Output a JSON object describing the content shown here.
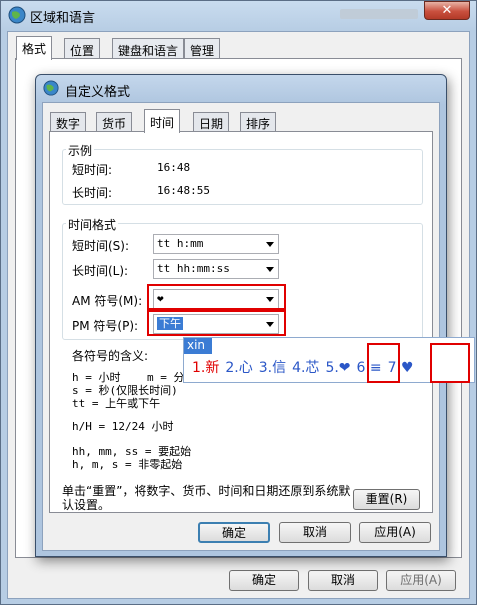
{
  "region_window": {
    "title": "区域和语言",
    "close_glyph": "✕",
    "tabs": [
      {
        "label": "格式"
      },
      {
        "label": "位置"
      },
      {
        "label": "键盘和语言"
      },
      {
        "label": "管理"
      }
    ],
    "buttons": {
      "ok": "确定",
      "cancel": "取消",
      "apply": "应用(A)"
    }
  },
  "custom_window": {
    "title": "自定义格式",
    "tabs": [
      {
        "label": "数字"
      },
      {
        "label": "货币"
      },
      {
        "label": "时间"
      },
      {
        "label": "日期"
      },
      {
        "label": "排序"
      }
    ],
    "example": {
      "group_label": "示例",
      "short_time_label": "短时间:",
      "short_time_value": "16:48",
      "long_time_label": "长时间:",
      "long_time_value": "16:48:55"
    },
    "time_format": {
      "group_label": "时间格式",
      "short_time_label": "短时间(S):",
      "short_time_value": "tt h:mm",
      "long_time_label": "长时间(L):",
      "long_time_value": "tt hh:mm:ss",
      "am_label": "AM 符号(M):",
      "am_value": "❤",
      "pm_label": "PM 符号(P):",
      "pm_value": "下午"
    },
    "meaning": {
      "title": "各符号的含义:",
      "line1": "h = 小时    m = 分钟",
      "line2": "s = 秒(仅限长时间)",
      "line3": "tt = 上午或下午",
      "line4": "h/H = 12/24 小时",
      "line5": "hh, mm, ss = 要起始",
      "line6": "h, m, s = 非零起始"
    },
    "reset_text": "单击“重置”，将数字、货币、时间和日期还原到系统默认设置。",
    "reset_button": "重置(R)",
    "buttons": {
      "ok": "确定",
      "cancel": "取消",
      "apply": "应用(A)"
    }
  },
  "ime": {
    "pinyin": "xin",
    "candidates": [
      "1.新",
      "2.心",
      "3.信",
      "4.芯",
      "5.❤",
      "6.≡",
      "7.♥"
    ]
  },
  "colors": {
    "highlight_red": "#e00000",
    "ime_blue": "#2b57c7"
  }
}
